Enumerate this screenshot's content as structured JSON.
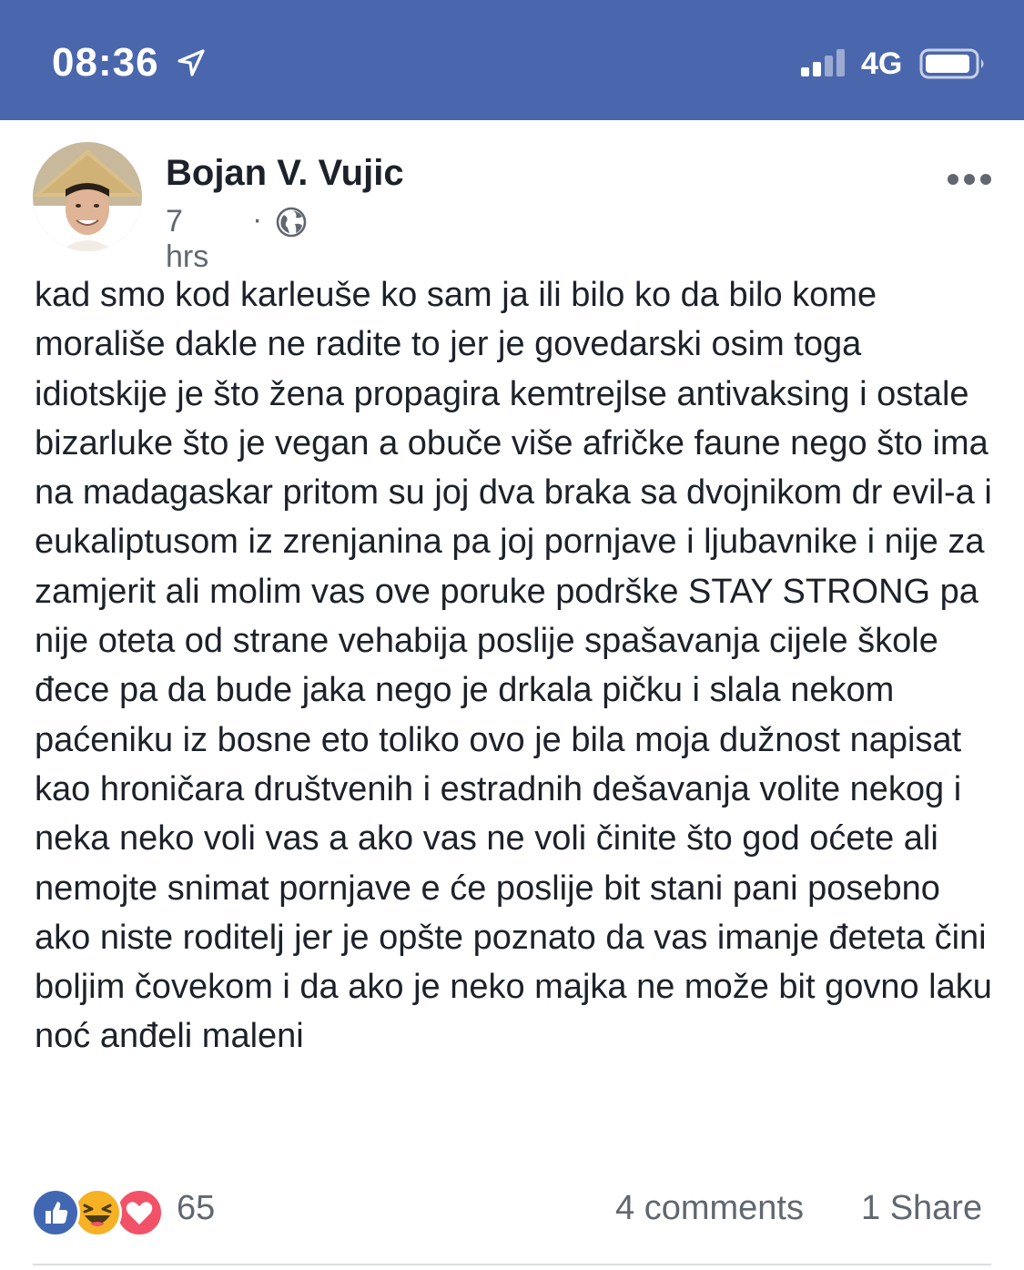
{
  "status_bar": {
    "time": "08:36",
    "network": "4G",
    "icons": [
      "location-arrow-icon",
      "cellular-signal-icon",
      "battery-icon"
    ],
    "background_color": "#4a67ad"
  },
  "post": {
    "author": "Bojan V. Vujic",
    "time_ago": "7 hrs",
    "separator": "·",
    "privacy_icon": "globe-icon",
    "more_icon": "more-horizontal-icon",
    "text": "kad smo kod karleuše ko sam ja ili bilo ko da bilo kome morališe dakle ne radite to jer je govedarski osim toga idiotskije je što žena propagira kemtrejlse antivaksing i ostale bizarluke što je vegan a obuče više afričke faune nego što ima na madagaskar pritom su joj dva braka sa dvojnikom dr evil-a i eukaliptusom iz zrenjanina pa joj pornjave i ljubavnike i nije za zamjerit ali molim vas ove poruke podrške STAY STRONG pa nije oteta od strane vehabija poslije spašavanja cijele škole đece pa da bude jaka nego je drkala pičku i slala nekom paćeniku iz bosne eto toliko ovo je bila moja dužnost napisat kao hroničara društvenih i estradnih dešavanja volite nekog i neka neko voli vas a ako vas ne voli činite što god oćete ali nemojte snimat pornjave e će poslije bit stani pani posebno ako niste roditelj jer je opšte poznato da vas imanje đeteta čini boljim čovekom i da ako je neko majka ne može bit govno laku noć anđeli maleni"
  },
  "footer": {
    "reaction_icons": [
      "like-icon",
      "haha-icon",
      "love-icon"
    ],
    "reaction_count": "65",
    "comments": "4 comments",
    "shares": "1 Share"
  }
}
